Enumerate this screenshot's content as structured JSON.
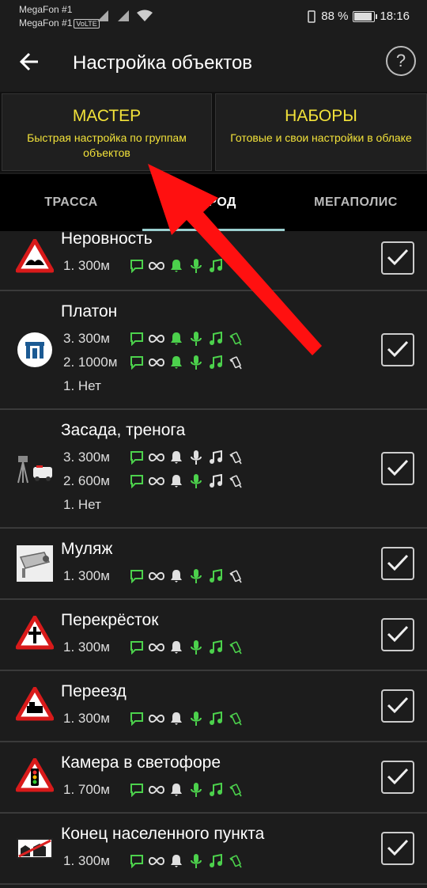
{
  "status": {
    "operator1": "MegaFon #1",
    "operator2": "MegaFon #1",
    "volte": "VoLTE",
    "battery": "88 %",
    "battery_level": 0.88,
    "time": "18:16"
  },
  "appbar": {
    "title": "Настройка объектов",
    "help": "?"
  },
  "cards": [
    {
      "title": "МАСТЕР",
      "subtitle": "Быстрая настройка по группам объектов"
    },
    {
      "title": "НАБОРЫ",
      "subtitle": "Готовые и свои настройки в облаке"
    }
  ],
  "tabs": [
    {
      "label": "ТРАССА"
    },
    {
      "label": "ГОРОД"
    },
    {
      "label": "МЕГАПОЛИС"
    }
  ],
  "active_tab": 1,
  "colors": {
    "accent": "#f2e23a",
    "green": "#4cd14c",
    "white": "#e0e0e0",
    "tab_indicator": "#9acfcf",
    "arrow": "#ff1010"
  },
  "items": [
    {
      "name": "Неровность",
      "icon": "bump-warning-icon",
      "lines": [
        {
          "d": "1. 300м",
          "on": [
            1,
            1,
            1,
            1,
            0
          ]
        }
      ],
      "checked": true
    },
    {
      "name": "Платон",
      "icon": "platon-icon",
      "lines": [
        {
          "d": "3. 300м",
          "on": [
            1,
            1,
            1,
            1,
            1
          ]
        },
        {
          "d": "2. 1000м",
          "on": [
            1,
            1,
            1,
            1,
            0
          ]
        },
        {
          "d": "1. Нет"
        }
      ],
      "checked": true
    },
    {
      "name": "Засада, тренога",
      "icon": "ambush-tripod-icon",
      "lines": [
        {
          "d": "3. 300м",
          "on": [
            1,
            0,
            0,
            0,
            0
          ]
        },
        {
          "d": "2. 600м",
          "on": [
            1,
            0,
            1,
            0,
            0
          ]
        },
        {
          "d": "1. Нет"
        }
      ],
      "checked": true
    },
    {
      "name": "Муляж",
      "icon": "dummy-camera-icon",
      "lines": [
        {
          "d": "1. 300м",
          "on": [
            1,
            0,
            1,
            1,
            0
          ]
        }
      ],
      "checked": true
    },
    {
      "name": "Перекрёсток",
      "icon": "crossroad-warning-icon",
      "lines": [
        {
          "d": "1. 300м",
          "on": [
            1,
            0,
            1,
            1,
            1
          ]
        }
      ],
      "checked": true
    },
    {
      "name": "Переезд",
      "icon": "railway-crossing-icon",
      "lines": [
        {
          "d": "1. 300м",
          "on": [
            1,
            0,
            1,
            1,
            1
          ]
        }
      ],
      "checked": true
    },
    {
      "name": "Камера в светофоре",
      "icon": "traffic-light-warning-icon",
      "lines": [
        {
          "d": "1. 700м",
          "on": [
            1,
            0,
            1,
            1,
            1
          ]
        }
      ],
      "checked": true
    },
    {
      "name": "Конец населенного пункта",
      "icon": "settlement-end-sign-icon",
      "lines": [
        {
          "d": "1. 300м",
          "on": [
            1,
            0,
            1,
            1,
            1
          ]
        }
      ],
      "checked": true
    }
  ]
}
